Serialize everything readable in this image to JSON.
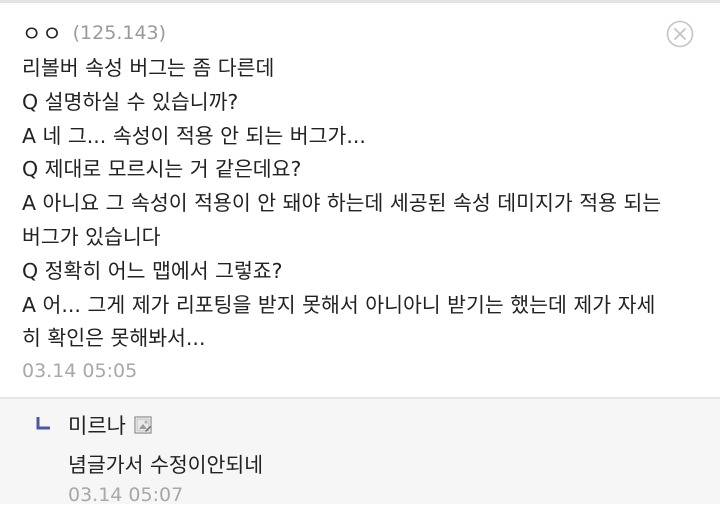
{
  "comment": {
    "author": "ㅇㅇ",
    "ip": "(125.143)",
    "lines": [
      "리볼버 속성 버그는 좀 다른데",
      "Q 설명하실 수 있습니까?",
      "A 네 그... 속성이 적용 안 되는 버그가...",
      "Q 제대로 모르시는 거 같은데요?",
      "A 아니요 그 속성이 적용이 안 돼야 하는데 세공된 속성 데미지가 적용 되는",
      "버그가 있습니다",
      "Q 정확히 어느 맵에서 그렇죠?",
      "A 어... 그게 제가 리포팅을 받지 못해서 아니아니 받기는 했는데 제가 자세",
      "히 확인은 못해봐서..."
    ],
    "timestamp": "03.14 05:05",
    "close_icon": "close-circle-icon"
  },
  "reply": {
    "author": "미르나",
    "member_icon": "member-badge-icon",
    "text": "념글가서 수정이안되네",
    "timestamp": "03.14 05:07"
  },
  "colors": {
    "text": "#222222",
    "meta": "#a8a8a8",
    "reply_bg": "#f6f6f6",
    "reply_arrow": "#4a5aa0"
  }
}
